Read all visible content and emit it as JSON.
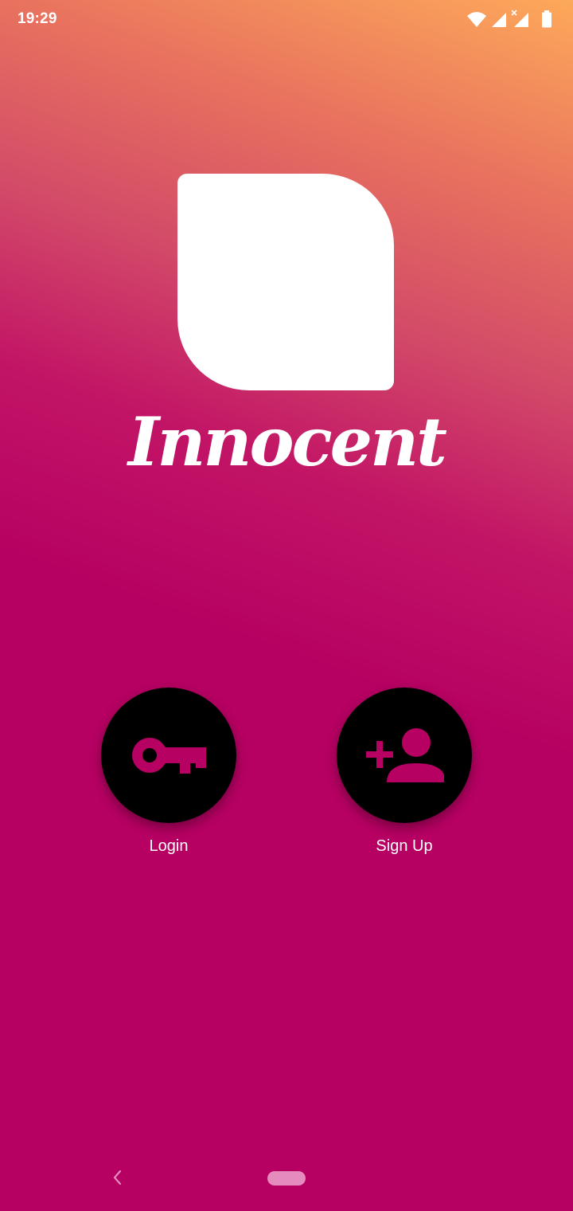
{
  "status_bar": {
    "time": "19:29",
    "icons": [
      "wifi-icon",
      "signal-icon",
      "signal-no-data-icon",
      "battery-icon"
    ]
  },
  "app": {
    "name": "Innocent",
    "logo": "app-logo-shape"
  },
  "actions": {
    "login": {
      "label": "Login",
      "icon": "key-icon"
    },
    "signup": {
      "label": "Sign Up",
      "icon": "add-person-icon"
    }
  },
  "nav": {
    "back_icon": "back-chevron-icon",
    "home_icon": "home-pill"
  },
  "colors": {
    "background": "#b60062",
    "gradient_top": "#fda95a",
    "accent_icon": "#b60062",
    "button": "#000000",
    "text": "#ffffff"
  }
}
